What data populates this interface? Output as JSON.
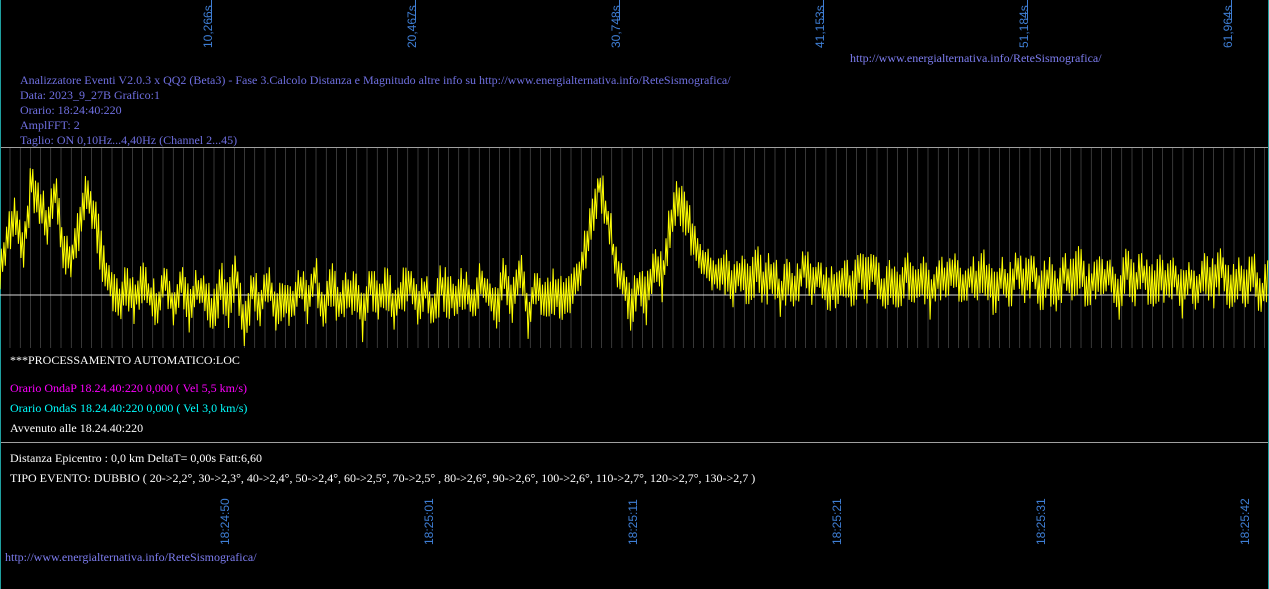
{
  "top_axis": {
    "labels": [
      "10,266s",
      "20,467s",
      "30,748s",
      "41,153s",
      "51,184s",
      "61,964s"
    ]
  },
  "top_url": "http://www.energialternativa.info/ReteSismografica/",
  "header": {
    "line1": "Analizzatore Eventi V2.0.3 x QQ2 (Beta3) - Fase 3.Calcolo Distanza e Magnitudo altre info su http://www.energialternativa.info/ReteSismografica/",
    "line2": "Data: 2023_9_27B Grafico:1",
    "line3": "Orario: 18:24:40:220",
    "line4": "AmplFFT: 2",
    "line5": "Taglio: ON 0,10Hz...4,40Hz       (Channel 2...45)"
  },
  "processing": {
    "title": "***PROCESSAMENTO AUTOMATICO:LOC",
    "onda_p": "Orario OndaP 18.24.40:220  0,000 ( Vel 5,5 km/s)",
    "onda_s": "Orario OndaS 18.24.40:220  0,000 ( Vel 3,0 km/s)",
    "avvenuto": "Avvenuto alle 18.24.40:220"
  },
  "results": {
    "distanza": "Distanza Epicentro : 0,0 km DeltaT= 0,00s  Fatt:6,60",
    "tipo_evento": "TIPO EVENTO: DUBBIO ( 20->2,2°, 30->2,3°, 40->2,4°, 50->2,4°, 60->2,5°, 70->2,5° , 80->2,6°, 90->2,6°, 100->2,6°, 110->2,7°, 120->2,7°, 130->2,7 )"
  },
  "bottom_axis": {
    "labels": [
      "18:24:50",
      "18:25:01",
      "18:25:11",
      "18:25:21",
      "18:25:31",
      "18:25:42"
    ]
  },
  "bottom_url": "http://www.energialternativa.info/ReteSismografica/",
  "colors": {
    "background": "#000000",
    "trace": "#ffff00",
    "axis_labels": "#3f7fd6",
    "onda_p": "#ff00ff",
    "onda_s": "#00ffff",
    "header": "#6f6fe0",
    "grid": "#6e6e6e"
  },
  "chart_data": {
    "type": "line",
    "title": "",
    "xlabel": "",
    "ylabel": "",
    "x_ticks_top": [
      "10,266s",
      "20,467s",
      "30,748s",
      "41,153s",
      "51,184s",
      "61,964s"
    ],
    "x_ticks_bottom": [
      "18:24:50",
      "18:25:01",
      "18:25:11",
      "18:25:21",
      "18:25:31",
      "18:25:42"
    ],
    "series": [
      {
        "values": [
          0.2,
          0.5,
          0.7,
          0.4,
          1.0,
          0.8,
          0.6,
          0.9,
          0.4,
          0.3,
          0.6,
          0.9,
          0.7,
          0.3,
          0.1,
          -0.1,
          0.05,
          -0.05,
          0.1,
          0.0,
          -0.1,
          0.15,
          -0.1,
          0.1,
          -0.15,
          0.05,
          0.0,
          -0.2,
          0.1,
          -0.1,
          0.2,
          -0.3,
          0.05,
          -0.1,
          0.15,
          -0.2,
          0.0,
          -0.1,
          0.1,
          -0.05,
          0.2,
          -0.15,
          0.1,
          -0.1,
          0.0,
          0.05,
          -0.2,
          0.1,
          -0.05,
          0.05,
          -0.1,
          0.0,
          0.15,
          -0.1,
          0.05,
          -0.15,
          0.1,
          -0.05,
          0.0,
          0.05,
          -0.1,
          0.1,
          0.0,
          -0.15,
          0.2,
          -0.1,
          0.25,
          -0.2,
          0.1,
          -0.1,
          0.05,
          0.0,
          -0.05,
          0.1,
          0.3,
          0.6,
          1.0,
          0.7,
          0.3,
          0.1,
          -0.1,
          0.1,
          -0.05,
          0.3,
          0.15,
          0.6,
          0.85,
          0.7,
          0.5,
          0.3,
          0.25,
          0.15,
          0.2,
          0.1,
          0.2,
          0.05,
          0.25,
          0.1,
          0.2,
          0.0,
          0.15,
          0.05,
          0.25,
          0.1,
          0.2,
          0.0,
          0.1,
          0.15,
          0.05,
          0.2,
          0.1,
          0.25,
          0.0,
          0.15,
          0.05,
          0.2,
          0.1,
          0.15,
          0.0,
          0.2,
          0.1,
          0.25,
          0.05,
          0.15,
          0.1,
          0.2,
          0.0,
          0.15,
          0.05,
          0.25,
          0.1,
          0.2,
          0.05,
          0.15,
          0.0,
          0.2,
          0.1,
          0.25,
          0.05,
          0.15,
          0.1,
          0.2,
          0.0,
          0.25,
          0.1,
          0.2,
          0.05,
          0.15,
          0.1,
          0.2,
          0.0,
          0.15,
          0.05,
          0.2,
          0.1,
          0.25,
          0.05,
          0.15,
          0.1,
          0.2,
          0.0,
          0.15
        ]
      }
    ],
    "ylim": [
      -0.4,
      1.1
    ],
    "grid": true
  }
}
